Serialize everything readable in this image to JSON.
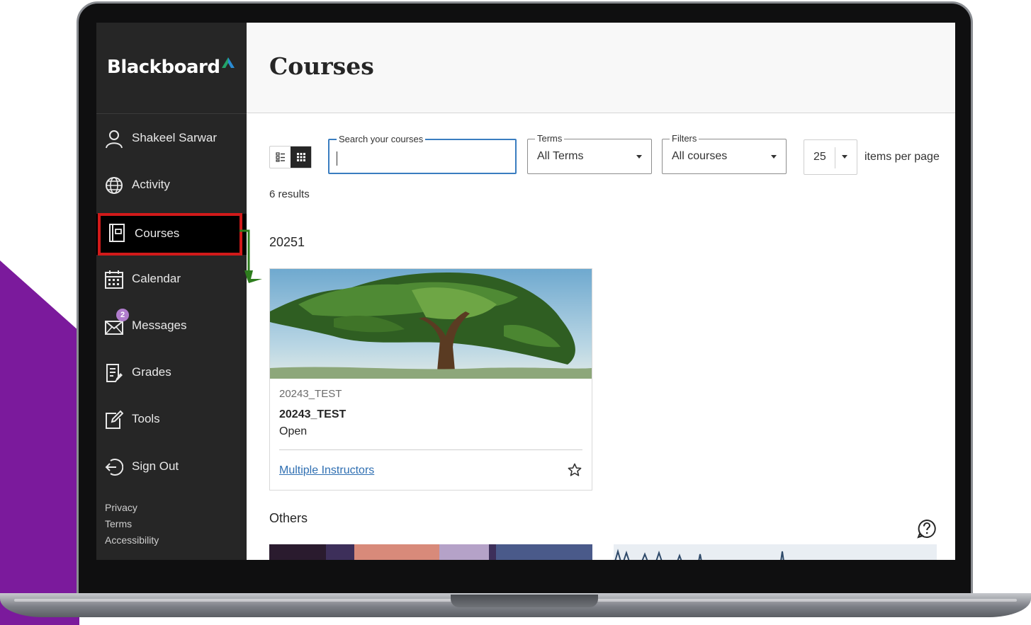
{
  "brand": {
    "name": "Blackboard",
    "accent_color": "#2a8bd3",
    "accent_color_2": "#22a36a"
  },
  "page": {
    "title": "Courses"
  },
  "sidebar": {
    "items": [
      {
        "label": "Shakeel Sarwar",
        "icon": "user-icon"
      },
      {
        "label": "Activity",
        "icon": "globe-icon"
      },
      {
        "label": "Courses",
        "icon": "course-book-icon",
        "active": true
      },
      {
        "label": "Calendar",
        "icon": "calendar-icon"
      },
      {
        "label": "Messages",
        "icon": "envelope-icon",
        "badge": "2"
      },
      {
        "label": "Grades",
        "icon": "grades-icon"
      },
      {
        "label": "Tools",
        "icon": "tools-icon"
      },
      {
        "label": "Sign Out",
        "icon": "sign-out-icon"
      }
    ],
    "footer_links": [
      "Privacy",
      "Terms",
      "Accessibility"
    ]
  },
  "toolbar": {
    "view_modes": [
      "list-view-icon",
      "grid-view-icon"
    ],
    "selected_view": "grid",
    "search": {
      "legend": "Search your courses",
      "value": ""
    },
    "terms": {
      "legend": "Terms",
      "value": "All Terms"
    },
    "filters": {
      "legend": "Filters",
      "value": "All courses"
    },
    "per_page": {
      "value": "25",
      "label": "items per page"
    }
  },
  "results_text": "6 results",
  "groups": [
    {
      "heading": "20251",
      "courses": [
        {
          "course_id": "20243_TEST",
          "title": "20243_TEST",
          "status": "Open",
          "instructors_link": "Multiple Instructors",
          "favorite": false
        }
      ]
    },
    {
      "heading": "Others"
    }
  ],
  "colors": {
    "sidebar_bg": "#262626",
    "active_outline": "#d11a1a",
    "badge": "#b07ccc",
    "background_shape": "#7b1a9c",
    "annotation_arrow": "#2e7d1e",
    "link": "#2f6fb2",
    "search_focus": "#3a7dc0"
  }
}
